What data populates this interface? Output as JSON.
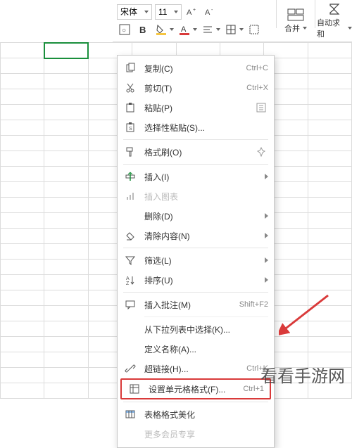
{
  "toolbar": {
    "font_name": "宋体",
    "font_size": "11",
    "merge_label": "合并",
    "autosum_label": "自动求和"
  },
  "context_menu": {
    "items": [
      {
        "label": "复制(C)",
        "shortcut": "Ctrl+C",
        "icon": "copy-icon"
      },
      {
        "label": "剪切(T)",
        "shortcut": "Ctrl+X",
        "icon": "cut-icon"
      },
      {
        "label": "粘贴(P)",
        "shortcut": "",
        "icon": "paste-icon",
        "right_icon": "paste-options-icon"
      },
      {
        "label": "选择性粘贴(S)...",
        "shortcut": "",
        "icon": "paste-special-icon"
      },
      {
        "sep": true
      },
      {
        "label": "格式刷(O)",
        "shortcut": "",
        "icon": "format-painter-icon",
        "right_icon": "pin-icon"
      },
      {
        "sep": true
      },
      {
        "label": "插入(I)",
        "shortcut": "",
        "icon": "insert-icon",
        "submenu": true
      },
      {
        "label": "插入图表",
        "shortcut": "",
        "icon": "insert-chart-icon",
        "disabled": true
      },
      {
        "label": "删除(D)",
        "shortcut": "",
        "icon": "",
        "submenu": true
      },
      {
        "label": "清除内容(N)",
        "shortcut": "",
        "icon": "clear-icon",
        "submenu": true
      },
      {
        "sep": true
      },
      {
        "label": "筛选(L)",
        "shortcut": "",
        "icon": "filter-icon",
        "submenu": true
      },
      {
        "label": "排序(U)",
        "shortcut": "",
        "icon": "sort-icon",
        "submenu": true
      },
      {
        "sep": true
      },
      {
        "label": "插入批注(M)",
        "shortcut": "Shift+F2",
        "icon": "comment-icon"
      },
      {
        "sep_lite": true
      },
      {
        "label": "从下拉列表中选择(K)...",
        "shortcut": "",
        "icon": ""
      },
      {
        "label": "定义名称(A)...",
        "shortcut": "",
        "icon": ""
      },
      {
        "label": "超链接(H)...",
        "shortcut": "Ctrl+K",
        "icon": "hyperlink-icon"
      },
      {
        "label": "设置单元格格式(F)...",
        "shortcut": "Ctrl+1",
        "icon": "format-cells-icon",
        "highlight": true
      },
      {
        "sep": true
      },
      {
        "label": "表格格式美化",
        "shortcut": "",
        "icon": "table-beautify-icon"
      }
    ],
    "more_label": "更多会员专享"
  },
  "watermark": "看看手游网",
  "colors": {
    "selection": "#1a8f3c",
    "highlight": "#d93a3a"
  }
}
